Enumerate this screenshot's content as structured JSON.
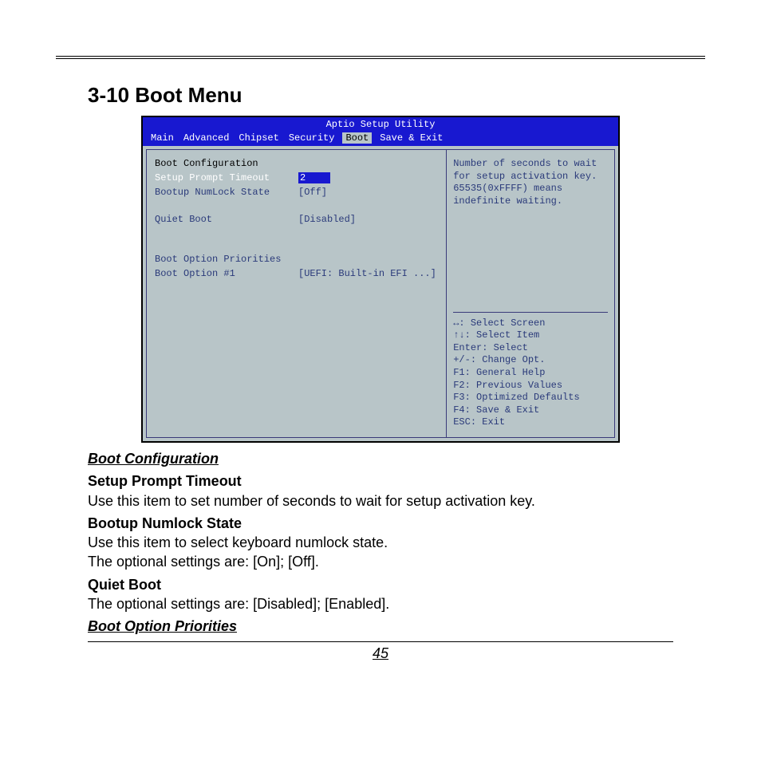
{
  "section_title": "3-10 Boot Menu",
  "bios": {
    "header": "Aptio Setup Utility",
    "tabs": [
      "Main",
      "Advanced",
      "Chipset",
      "Security",
      "Boot",
      "Save & Exit"
    ],
    "active_tab": "Boot",
    "left": {
      "group1_title": "Boot Configuration",
      "setup_prompt_label": "Setup Prompt Timeout",
      "setup_prompt_value": "2",
      "numlock_label": "Bootup NumLock State",
      "numlock_value": "[Off]",
      "quiet_label": "Quiet Boot",
      "quiet_value": "[Disabled]",
      "group2_title": "Boot Option Priorities",
      "boot1_label": "Boot Option #1",
      "boot1_value": "[UEFI: Built-in EFI ...]"
    },
    "right": {
      "help_top": "Number of seconds to wait for setup activation key. 65535(0xFFFF) means indefinite waiting.",
      "hints": [
        "↔: Select Screen",
        "↑↓: Select Item",
        "Enter: Select",
        "+/-: Change Opt.",
        "F1: General Help",
        "F2: Previous Values",
        "F3: Optimized Defaults",
        "F4: Save & Exit",
        "ESC: Exit"
      ]
    }
  },
  "doc": {
    "h1": "Boot Configuration",
    "s1_title": "Setup Prompt Timeout",
    "s1_body": "Use this item to set number of seconds to wait for setup activation key.",
    "s2_title": "Bootup Numlock State",
    "s2_body1": "Use this item to select keyboard numlock state.",
    "s2_body2": "The optional settings are: [On]; [Off].",
    "s3_title": "Quiet Boot",
    "s3_body": "The optional settings are: [Disabled]; [Enabled].",
    "h2": "Boot Option Priorities"
  },
  "page_number": "45"
}
